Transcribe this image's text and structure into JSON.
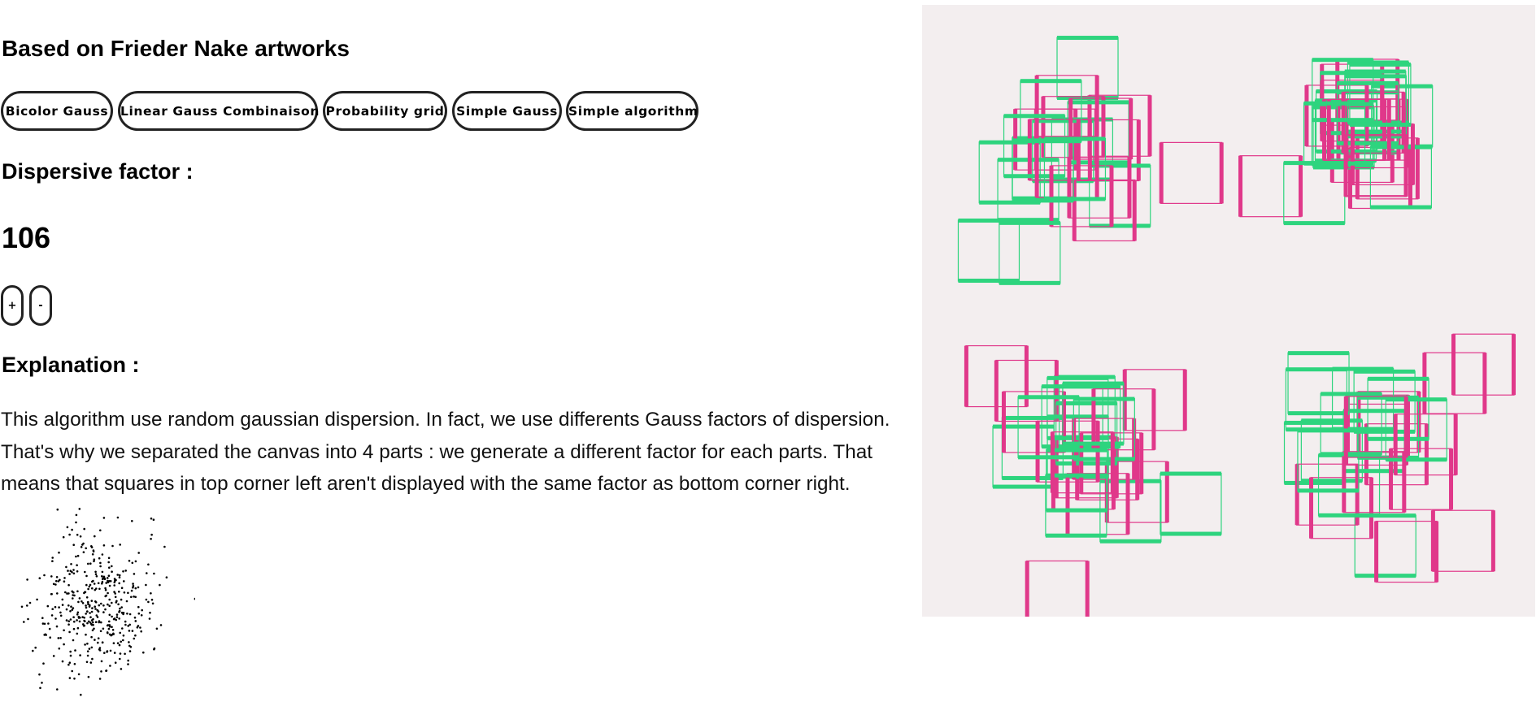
{
  "header": {
    "title": "Based on Frieder Nake artworks"
  },
  "algorithms": {
    "buttons": [
      "Bicolor Gauss",
      "Linear Gauss Combinaison",
      "Probability grid",
      "Simple Gauss",
      "Simple algorithm"
    ]
  },
  "dispersive": {
    "label": "Dispersive factor :",
    "value": "106",
    "increment_label": "+",
    "decrement_label": "-"
  },
  "explanation": {
    "label": "Explanation :",
    "text": "This algorithm use random gaussian dispersion. In fact, we use differents Gauss factors of dispersion. That's why we separated the canvas into 4 parts : we generate a different factor for each parts. That means that squares in top corner left aren't displayed with the same factor as bottom corner right."
  },
  "artwork": {
    "background_color": "#f3eeef",
    "pink_color": "#e0388a",
    "green_color": "#2ed47e"
  },
  "dispersion_plot": {
    "dot_color": "#000000"
  }
}
